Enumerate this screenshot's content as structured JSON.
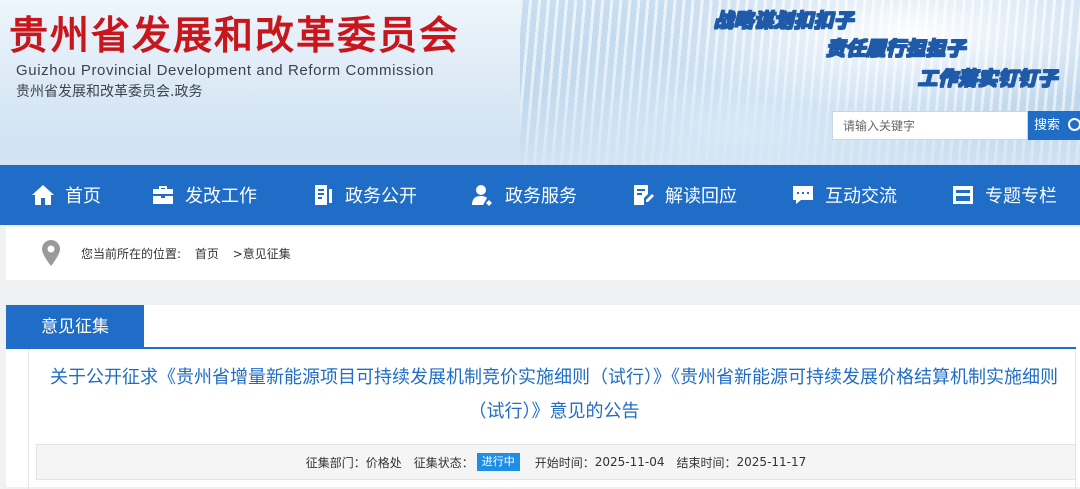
{
  "header": {
    "title_cn": "贵州省发展和改革委员会",
    "title_en": "Guizhou Provincial Development and Reform Commission",
    "domain": "贵州省发展和改革委员会.政务",
    "slogans": [
      "战略谋划扣扣子",
      "责任履行担担子",
      "工作落实钉钉子"
    ],
    "search": {
      "placeholder": "请输入关键字",
      "button_label": "搜索"
    }
  },
  "nav": {
    "items": [
      {
        "label": "首页",
        "icon": "home-icon"
      },
      {
        "label": "发改工作",
        "icon": "briefcase-icon"
      },
      {
        "label": "政务公开",
        "icon": "document-icon"
      },
      {
        "label": "政务服务",
        "icon": "user-service-icon"
      },
      {
        "label": "解读回应",
        "icon": "edit-document-icon"
      },
      {
        "label": "互动交流",
        "icon": "chat-icon"
      },
      {
        "label": "专题专栏",
        "icon": "column-icon"
      }
    ]
  },
  "breadcrumb": {
    "prefix": "您当前所在的位置:",
    "home": "首页",
    "current": ">意见征集"
  },
  "panel": {
    "tab_label": "意见征集",
    "article_title": "关于公开征求《贵州省增量新能源项目可持续发展机制竞价实施细则（试行）》《贵州省新能源可持续发展价格结算机制实施细则（试行）》意见的公告",
    "meta": {
      "dept_label": "征集部门：",
      "dept_value": "价格处",
      "status_label": "征集状态：",
      "status_value": "进行中",
      "start_label": "开始时间：",
      "start_value": "2025-11-04",
      "end_label": "结束时间：",
      "end_value": "2025-11-17"
    }
  },
  "colors": {
    "brand_red": "#c8161d",
    "nav_blue": "#1f6dc6",
    "badge_blue": "#1f8fe6"
  }
}
